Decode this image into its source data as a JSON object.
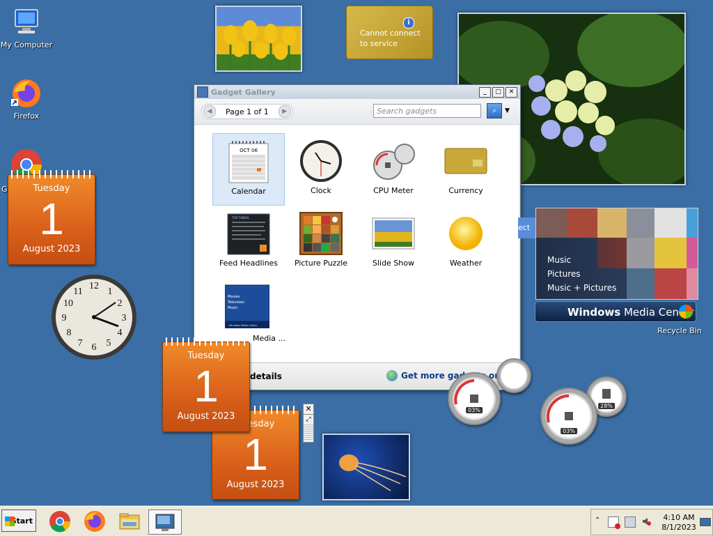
{
  "desktop": {
    "icons": [
      {
        "label": "My Computer",
        "icon": "computer-icon"
      },
      {
        "label": "Firefox",
        "icon": "firefox-icon"
      },
      {
        "label": "Go",
        "icon": "chrome-icon"
      },
      {
        "label": "Recycle Bin",
        "icon": "recycle-bin-icon"
      }
    ]
  },
  "calendars": [
    {
      "dow": "Tuesday",
      "day": "1",
      "month_year": "August 2023"
    },
    {
      "dow": "Tuesday",
      "day": "1",
      "month_year": "August 2023"
    },
    {
      "dow": "esday",
      "day": "1",
      "month_year": "August 2023"
    }
  ],
  "currency_gadget": {
    "line1": "Cannot connect",
    "line2": "to service",
    "icon": "info-icon"
  },
  "gallery": {
    "title": "Gadget Gallery",
    "page_label": "Page 1 of 1",
    "search_placeholder": "Search gadgets",
    "items": [
      {
        "label": "Calendar",
        "icon": "calendar-icon"
      },
      {
        "label": "Clock",
        "icon": "clock-icon"
      },
      {
        "label": "CPU Meter",
        "icon": "cpu-meter-icon"
      },
      {
        "label": "Currency",
        "icon": "currency-icon"
      },
      {
        "label": "Feed Headlines",
        "icon": "feed-headlines-icon"
      },
      {
        "label": "Picture Puzzle",
        "icon": "picture-puzzle-icon"
      },
      {
        "label": "Slide Show",
        "icon": "slide-show-icon"
      },
      {
        "label": "Weather",
        "icon": "weather-icon"
      },
      {
        "label": "Media ...",
        "icon": "media-center-icon"
      }
    ],
    "mini_calendar": {
      "month": "OCT 06"
    },
    "feed_lines": "TOP THINGS",
    "media_lines": [
      "Movies",
      "Television",
      "Music"
    ],
    "media_strip": "Windows Media Center",
    "details_label": "details",
    "more_online": "Get more gadgets online"
  },
  "cpu_meters": [
    {
      "cpu": "03%",
      "mem": ""
    },
    {
      "cpu": "03%",
      "mem": "28%"
    }
  ],
  "media_center": {
    "items": [
      "Music",
      "Pictures",
      "Music + Pictures"
    ],
    "brand_bold": "Windows",
    "brand_rest": " Media Center",
    "edge_text": "ect"
  },
  "taskbar": {
    "start_label": "Start",
    "time": "4:10 AM",
    "date": "8/1/2023",
    "apps": [
      "chrome-icon",
      "firefox-icon",
      "file-explorer-icon",
      "desktop-icon"
    ]
  },
  "colors": {
    "desktop": "#3a6ea5",
    "calendar": "#e06a1c",
    "accent": "#2f6cc4"
  }
}
